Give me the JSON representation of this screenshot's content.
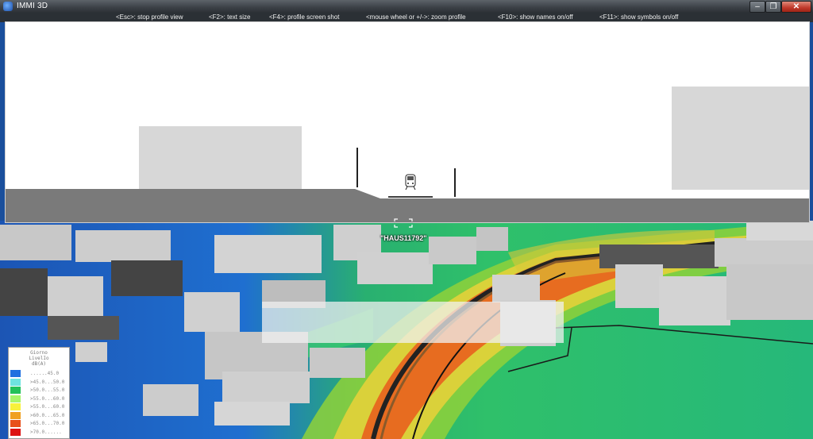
{
  "window": {
    "title": "IMMI 3D",
    "controls": {
      "minimize": "–",
      "maximize": "❐",
      "close": "✕"
    }
  },
  "hints": [
    "<Esc>: stop profile view",
    "<F2>: text size",
    "<F4>: profile screen shot",
    "<mouse wheel or +/->: zoom profile",
    "<F10>: show names on/off",
    "<F11>: show symbols on/off"
  ],
  "scene": {
    "building_label": "\"HAUS11792\"",
    "icons": {
      "train": "train-icon",
      "focus": "crosshair-icon"
    }
  },
  "legend": {
    "title_lines": [
      "Giorno",
      "LivelIo",
      "dB(A)"
    ],
    "entries": [
      {
        "label": "  ......45.0",
        "color": "#1f6fe0"
      },
      {
        "label": ">45.0...50.0",
        "color": "#6fe3e0"
      },
      {
        "label": ">50.0...55.0",
        "color": "#23c15a"
      },
      {
        "label": ">55.0...60.0",
        "color": "#a8f56a"
      },
      {
        "label": ">55.0...60.0",
        "color": "#f7f13b"
      },
      {
        "label": ">60.0...65.0",
        "color": "#f0a020"
      },
      {
        "label": ">65.0...70.0",
        "color": "#e8501a"
      },
      {
        "label": ">70.0......",
        "color": "#dd1111"
      }
    ]
  }
}
